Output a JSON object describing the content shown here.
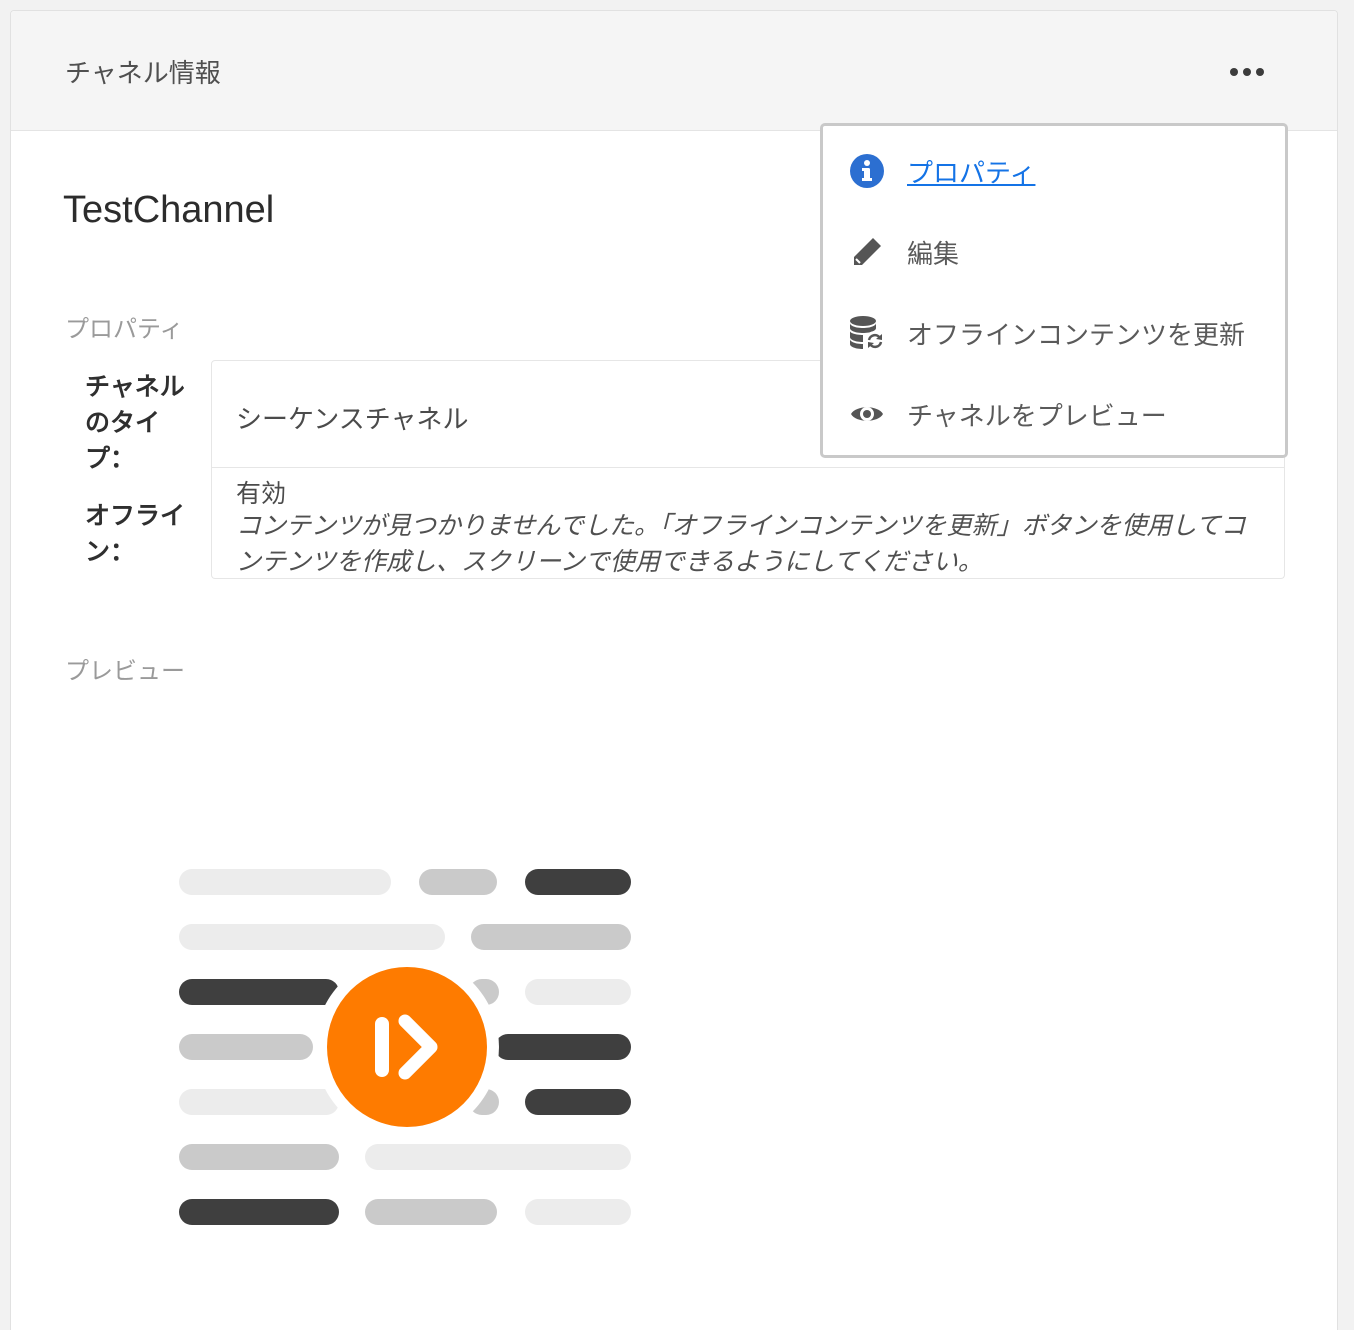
{
  "header": {
    "title": "チャネル情報"
  },
  "channel": {
    "name": "TestChannel"
  },
  "properties": {
    "section_label": "プロパティ",
    "type_label": "チャネルのタイプ：",
    "type_value": "シーケンスチャネル",
    "offline_label": "オフライン：",
    "offline_status": "有効",
    "offline_message": "コンテンツが見つかりませんでした。「オフラインコンテンツを更新」ボタンを使用してコンテンツを作成し、スクリーンで使用できるようにしてください。"
  },
  "preview": {
    "section_label": "プレビュー"
  },
  "menu": {
    "items": [
      {
        "label": "プロパティ",
        "icon": "info-icon",
        "active": true
      },
      {
        "label": "編集",
        "icon": "pencil-icon",
        "active": false
      },
      {
        "label": "オフラインコンテンツを更新",
        "icon": "database-refresh-icon",
        "active": false
      },
      {
        "label": "チャネルをプレビュー",
        "icon": "eye-icon",
        "active": false
      }
    ]
  },
  "colors": {
    "accent": "#1473e6",
    "brand_orange": "#fe7b00"
  }
}
